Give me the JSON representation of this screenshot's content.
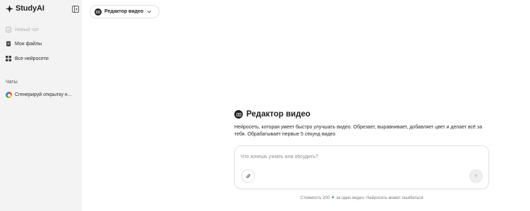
{
  "sidebar": {
    "logo_text": "StudyAI",
    "collapse_icon": "sidebar-collapse-icon",
    "nav": [
      {
        "label": "Новый чат",
        "icon": "new-chat-icon",
        "disabled": true
      },
      {
        "label": "Мои файлы",
        "icon": "file-icon",
        "disabled": false
      },
      {
        "label": "Все нейросети",
        "icon": "grid-icon",
        "disabled": false
      }
    ],
    "section_label": "Чаты",
    "chats": [
      {
        "label": "Сгенерируй открытку н...",
        "icon": "google-color-icon"
      }
    ]
  },
  "header": {
    "model_select_label": "Редактор видео"
  },
  "intro": {
    "title": "Редактор видео",
    "description": "Нейросеть, которая умеет быстро улучшать видео. Обрезает, выравнивает, добавляет цвет и делает всё за тебя. Обрабатывает первые 5 секунд видео"
  },
  "composer": {
    "placeholder": "Что хочешь узнать или обсудить?",
    "attach_icon": "paperclip-icon",
    "send_icon": "arrow-up-icon"
  },
  "footnote": {
    "before": "Стоимость 200",
    "spark_glyph": "✦",
    "after": "за одно видео. Нейросеть может ошибаться"
  },
  "colors": {
    "sidebar_bg": "#f3f3f4",
    "accent_spark": "#3b82f6"
  }
}
